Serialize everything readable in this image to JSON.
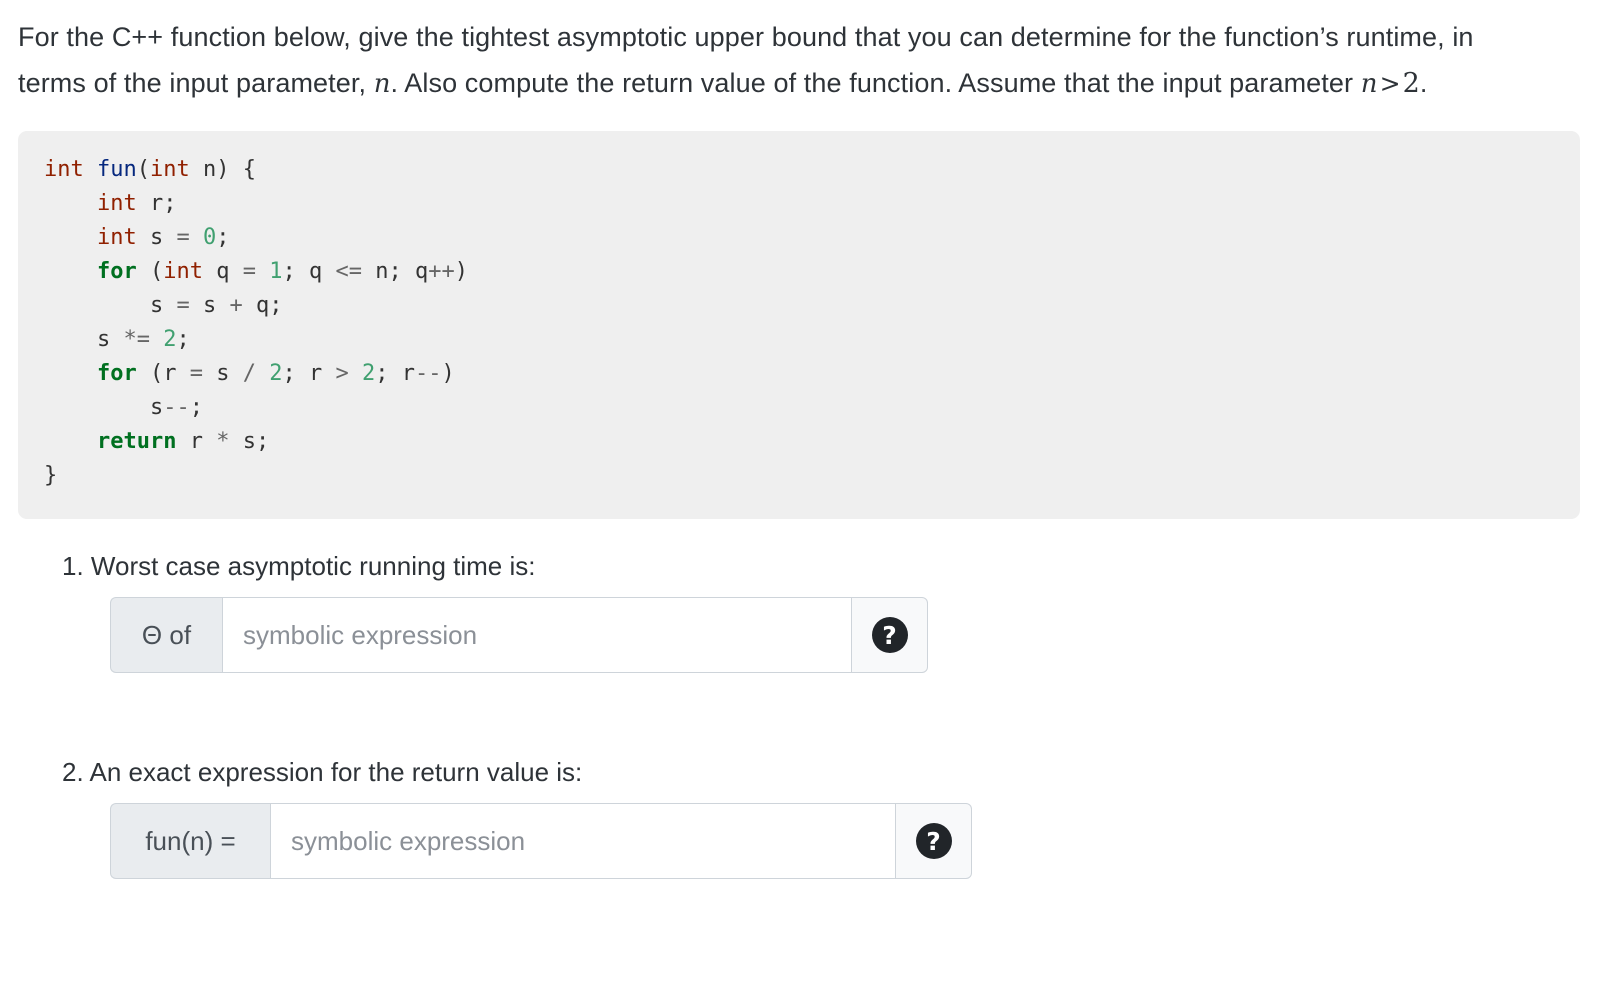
{
  "prompt": {
    "part1": "For the C++ function below, give the tightest asymptotic upper bound that you can determine for the function’s runtime, in terms of the input parameter, ",
    "var1": "n",
    "part2": ". Also compute the return value of the function. Assume that the input parameter ",
    "var2": "n",
    "operator": ">",
    "bound": "2",
    "period": "."
  },
  "code": {
    "language": "cpp",
    "lines": [
      [
        {
          "t": "int",
          "c": "kt"
        },
        {
          "t": " ",
          "c": "p"
        },
        {
          "t": "fun",
          "c": "nf"
        },
        {
          "t": "(",
          "c": "p"
        },
        {
          "t": "int",
          "c": "kt"
        },
        {
          "t": " n) {",
          "c": "p"
        }
      ],
      [
        {
          "t": "    ",
          "c": "p"
        },
        {
          "t": "int",
          "c": "kt"
        },
        {
          "t": " r;",
          "c": "p"
        }
      ],
      [
        {
          "t": "    ",
          "c": "p"
        },
        {
          "t": "int",
          "c": "kt"
        },
        {
          "t": " s ",
          "c": "p"
        },
        {
          "t": "=",
          "c": "o"
        },
        {
          "t": " ",
          "c": "p"
        },
        {
          "t": "0",
          "c": "mi"
        },
        {
          "t": ";",
          "c": "p"
        }
      ],
      [
        {
          "t": "    ",
          "c": "p"
        },
        {
          "t": "for",
          "c": "k"
        },
        {
          "t": " (",
          "c": "p"
        },
        {
          "t": "int",
          "c": "kt"
        },
        {
          "t": " q ",
          "c": "p"
        },
        {
          "t": "=",
          "c": "o"
        },
        {
          "t": " ",
          "c": "p"
        },
        {
          "t": "1",
          "c": "mi"
        },
        {
          "t": "; q ",
          "c": "p"
        },
        {
          "t": "<=",
          "c": "o"
        },
        {
          "t": " n; q",
          "c": "p"
        },
        {
          "t": "++",
          "c": "o"
        },
        {
          "t": ")",
          "c": "p"
        }
      ],
      [
        {
          "t": "        s ",
          "c": "p"
        },
        {
          "t": "=",
          "c": "o"
        },
        {
          "t": " s ",
          "c": "p"
        },
        {
          "t": "+",
          "c": "o"
        },
        {
          "t": " q;",
          "c": "p"
        }
      ],
      [
        {
          "t": "    s ",
          "c": "p"
        },
        {
          "t": "*=",
          "c": "o"
        },
        {
          "t": " ",
          "c": "p"
        },
        {
          "t": "2",
          "c": "mi"
        },
        {
          "t": ";",
          "c": "p"
        }
      ],
      [
        {
          "t": "    ",
          "c": "p"
        },
        {
          "t": "for",
          "c": "k"
        },
        {
          "t": " (r ",
          "c": "p"
        },
        {
          "t": "=",
          "c": "o"
        },
        {
          "t": " s ",
          "c": "p"
        },
        {
          "t": "/",
          "c": "o"
        },
        {
          "t": " ",
          "c": "p"
        },
        {
          "t": "2",
          "c": "mi"
        },
        {
          "t": "; r ",
          "c": "p"
        },
        {
          "t": ">",
          "c": "o"
        },
        {
          "t": " ",
          "c": "p"
        },
        {
          "t": "2",
          "c": "mi"
        },
        {
          "t": "; r",
          "c": "p"
        },
        {
          "t": "--",
          "c": "o"
        },
        {
          "t": ")",
          "c": "p"
        }
      ],
      [
        {
          "t": "        s",
          "c": "p"
        },
        {
          "t": "--",
          "c": "o"
        },
        {
          "t": ";",
          "c": "p"
        }
      ],
      [
        {
          "t": "    ",
          "c": "p"
        },
        {
          "t": "return",
          "c": "k"
        },
        {
          "t": " r ",
          "c": "p"
        },
        {
          "t": "*",
          "c": "o"
        },
        {
          "t": " s;",
          "c": "p"
        }
      ],
      [
        {
          "t": "}",
          "c": "b"
        }
      ]
    ],
    "plain_text": "int fun(int n) {\n    int r;\n    int s = 0;\n    for (int q = 1; q <= n; q++)\n        s = s + q;\n    s *= 2;\n    for (r = s / 2; r > 2; r--)\n        s--;\n    return r * s;\n}"
  },
  "questions": [
    {
      "label": "1. Worst case asymptotic running time is:",
      "prefix": "Θ of",
      "value": "",
      "placeholder": "symbolic expression",
      "help_glyph": "?"
    },
    {
      "label": "2. An exact expression for the return value is:",
      "prefix": "fun(n) =",
      "value": "",
      "placeholder": "symbolic expression",
      "help_glyph": "?"
    }
  ],
  "colors": {
    "code_background": "#efefef",
    "prefix_background": "#e9ecef",
    "help_background": "#f8f9fa",
    "help_circle": "#212529",
    "border": "#ced4da",
    "keyword": "#007020",
    "type": "#902000",
    "function_name": "#06287e",
    "number": "#40a070",
    "text": "#2e3338",
    "placeholder": "#8b9097"
  }
}
